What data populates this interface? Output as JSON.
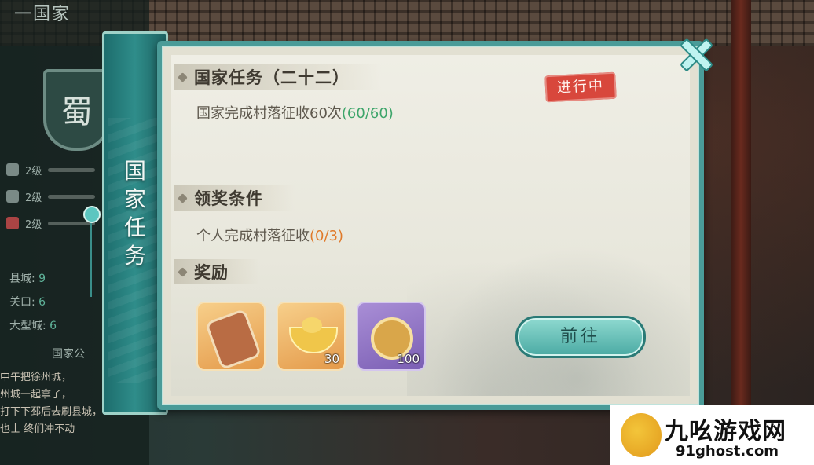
{
  "background": {
    "left_panel": {
      "country_title": "一国家",
      "emblem_char": "蜀",
      "stats": [
        {
          "label": "2级"
        },
        {
          "label": "2级"
        },
        {
          "label": "2级"
        }
      ],
      "info_lines": [
        {
          "label": "县城:",
          "value": "9"
        },
        {
          "label": "关口:",
          "value": "6"
        },
        {
          "label": "大型城:",
          "value": "6"
        }
      ],
      "notice_heading": "国家公",
      "notice_text": "中午把徐州城，\n州城一起拿了，\n打下下邳后去刷县城，\n也士 终们冲不动"
    }
  },
  "dialog": {
    "spine_title": "国家任务",
    "close_icon": "close-x-icon",
    "task": {
      "heading": "国家任务（二十二）",
      "status_stamp": "进行中",
      "description": "国家完成村落征收60次",
      "progress_text": "(60/60)"
    },
    "condition": {
      "heading": "领奖条件",
      "description": "个人完成村落征收",
      "progress_text": "(0/3)"
    },
    "rewards": {
      "heading": "奖励",
      "items": [
        {
          "icon": "token-icon",
          "quantity": ""
        },
        {
          "icon": "gold-ingot-icon",
          "quantity": "30"
        },
        {
          "icon": "medal-icon",
          "quantity": "100"
        }
      ]
    },
    "go_button_label": "前往"
  },
  "watermark": {
    "title": "九吆游戏网",
    "url": "91ghost.com"
  },
  "colors": {
    "frame_teal": "#4a9b98",
    "progress_green": "#3da56a",
    "progress_orange": "#e07a2a",
    "stamp_red": "#d8473c"
  }
}
